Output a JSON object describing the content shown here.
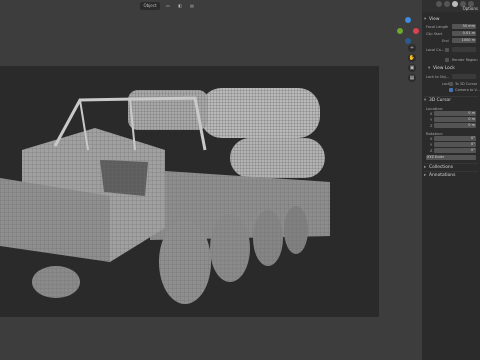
{
  "header": {
    "mode": "Object",
    "panel_tab": "Options"
  },
  "sidebar": {
    "view": {
      "title": "View",
      "focal_label": "Focal Length",
      "focal_value": "50 mm",
      "clip_label": "Clip Start",
      "clip_start": "0.01 m",
      "clip_end_label": "End",
      "clip_end": "1000 m",
      "local_camera_label": "Local Ca...",
      "local_camera_value": "",
      "render_region_label": "Render Region"
    },
    "view_lock": {
      "title": "View Lock",
      "lock_to_object_label": "Lock to Obj...",
      "lock_label": "Lock",
      "lock_3d_cursor": "To 3D Cursor",
      "camera_to_view": "Camera to V..."
    },
    "cursor": {
      "title": "3D Cursor",
      "location_label": "Location:",
      "loc": [
        {
          "axis": "X",
          "value": "0 m"
        },
        {
          "axis": "Y",
          "value": "0 m"
        },
        {
          "axis": "Z",
          "value": "0 m"
        }
      ],
      "rotation_label": "Rotation:",
      "rot": [
        {
          "axis": "X",
          "value": "0°"
        },
        {
          "axis": "Y",
          "value": "0°"
        },
        {
          "axis": "Z",
          "value": "0°"
        }
      ],
      "mode": "XYZ Euler"
    },
    "collections": {
      "title": "Collections"
    },
    "annotations": {
      "title": "Annotations"
    }
  },
  "colors": {
    "gizmo_x": "#d8434f",
    "gizmo_y": "#6ca92b",
    "gizmo_z": "#3e8be0",
    "accent": "#4772b3"
  }
}
